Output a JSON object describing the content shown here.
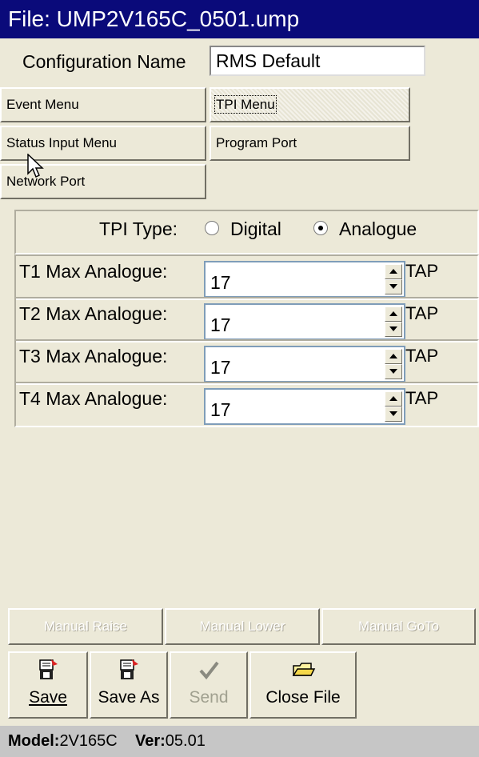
{
  "title": "File: UMP2V165C_0501.ump",
  "config": {
    "label": "Configuration Name",
    "value": "RMS Default"
  },
  "menus": {
    "event": "Event Menu",
    "tpi": "TPI Menu",
    "status_input": "Status Input Menu",
    "program_port": "Program Port",
    "network_port": "Network Port"
  },
  "tpi_type": {
    "label": "TPI Type:",
    "options": [
      "Digital",
      "Analogue"
    ],
    "selected": "Analogue"
  },
  "max_rows": [
    {
      "label": "T1 Max Analogue:",
      "value": "17",
      "unit": "TAP"
    },
    {
      "label": "T2 Max Analogue:",
      "value": "17",
      "unit": "TAP"
    },
    {
      "label": "T3 Max Analogue:",
      "value": "17",
      "unit": "TAP"
    },
    {
      "label": "T4 Max Analogue:",
      "value": "17",
      "unit": "TAP"
    }
  ],
  "manual": {
    "raise": "Manual Raise",
    "lower": "Manual Lower",
    "goto": "Manual GoTo"
  },
  "toolbar": {
    "save": {
      "label": "Save",
      "icon": "save-disk-icon"
    },
    "save_as": {
      "label": "Save As",
      "icon": "save-as-disk-icon"
    },
    "send": {
      "label": "Send",
      "icon": "checkmark-icon"
    },
    "close_file": {
      "label": "Close File",
      "icon": "open-folder-icon"
    }
  },
  "status": {
    "model_label": "Model:",
    "model": "2V165C",
    "ver_label": "Ver:",
    "ver": "05.01"
  },
  "colors": {
    "titlebar": "#0A0A7A",
    "face": "#ECE9D8",
    "statusbar": "#C6C6C6"
  }
}
